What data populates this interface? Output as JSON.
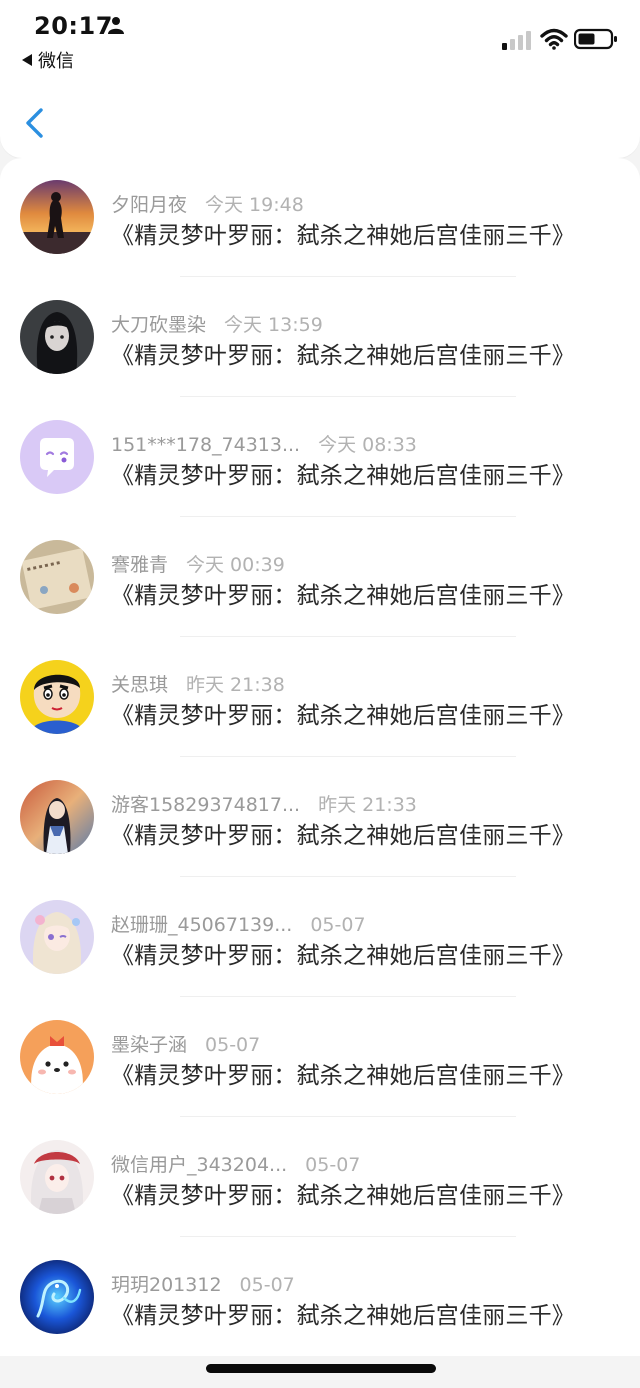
{
  "status_bar": {
    "time": "20:17",
    "back_app_label": "微信"
  },
  "comments": [
    {
      "name": "夕阳月夜",
      "time": "今天 19:48",
      "text": "《精灵梦叶罗丽：弑杀之神她后宫佳丽三千》",
      "avatar": "sunset-silhouette"
    },
    {
      "name": "大刀砍墨染",
      "time": "今天 13:59",
      "text": "《精灵梦叶罗丽：弑杀之神她后宫佳丽三千》",
      "avatar": "dark-anime-girl"
    },
    {
      "name": "151***178_74313...",
      "time": "今天 08:33",
      "text": "《精灵梦叶罗丽：弑杀之神她后宫佳丽三千》",
      "avatar": "purple-chat-bubble"
    },
    {
      "name": "謇雅青",
      "time": "今天 00:39",
      "text": "《精灵梦叶罗丽：弑杀之神她后宫佳丽三千》",
      "avatar": "notebook-photo"
    },
    {
      "name": "关思琪",
      "time": "昨天 21:38",
      "text": "《精灵梦叶罗丽：弑杀之神她后宫佳丽三千》",
      "avatar": "cartoon-boy"
    },
    {
      "name": "游客15829374817...",
      "time": "昨天 21:33",
      "text": "《精灵梦叶罗丽：弑杀之神她后宫佳丽三千》",
      "avatar": "anime-girl-traditional"
    },
    {
      "name": "赵珊珊_45067139...",
      "time": "05-07",
      "text": "《精灵梦叶罗丽：弑杀之神她后宫佳丽三千》",
      "avatar": "pastel-anime-girl"
    },
    {
      "name": "墨染子涵",
      "time": "05-07",
      "text": "《精灵梦叶罗丽：弑杀之神她后宫佳丽三千》",
      "avatar": "cute-puppy"
    },
    {
      "name": "微信用户_343204...",
      "time": "05-07",
      "text": "《精灵梦叶罗丽：弑杀之神她后宫佳丽三千》",
      "avatar": "white-hair-anime-girl"
    },
    {
      "name": "玥玥201312",
      "time": "05-07",
      "text": "《精灵梦叶罗丽：弑杀之神她后宫佳丽三千》",
      "avatar": "blue-dragon"
    }
  ],
  "colors": {
    "accent": "#1e90ff",
    "name_gray": "#9a9a9a",
    "text_dark": "#2a2a2a"
  }
}
